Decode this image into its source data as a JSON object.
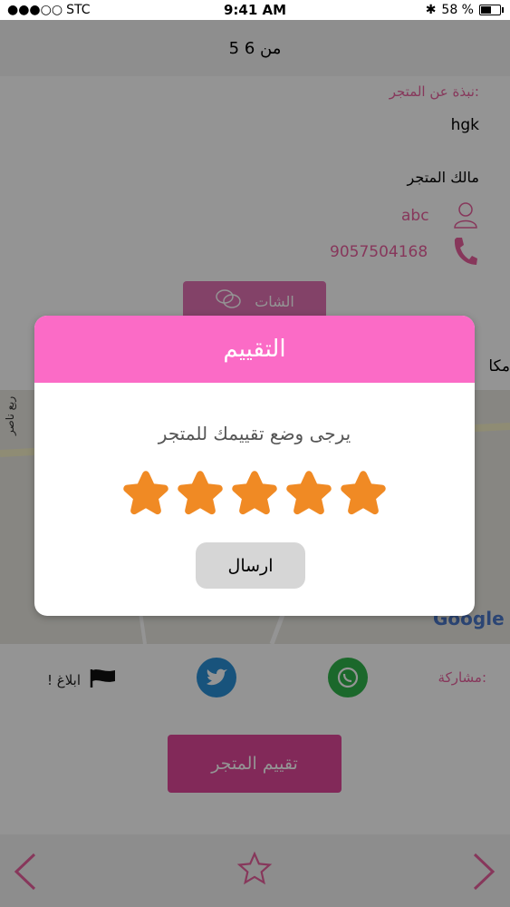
{
  "status_bar": {
    "carrier": "STC",
    "time": "9:41 AM",
    "battery_percent": "58 %",
    "battery_level": 0.58
  },
  "header": {
    "title": "5 من 6"
  },
  "store": {
    "about_label": ":نبذة عن المتجر",
    "about_value": "hgk",
    "owner_label": "مالك المتجر",
    "owner_name": "abc",
    "phone": "9057504168",
    "chat_label": "الشات",
    "location_label": "مكا"
  },
  "map": {
    "google_label": "Google",
    "street_label": "ربع ناصر"
  },
  "share": {
    "label": ":مشاركة",
    "report_label": "ابلاغ !"
  },
  "rate_store_button": "تقييم المتجر",
  "dialog": {
    "title": "التقييم",
    "message": "يرجى وضع تقييمك للمتجر",
    "rating": 5,
    "max_rating": 5,
    "send_label": "ارسال",
    "star_color": "#f08a24"
  },
  "colors": {
    "accent": "#fb6bc6",
    "pink_text": "#e8609e",
    "rate_button": "#e0479a"
  }
}
